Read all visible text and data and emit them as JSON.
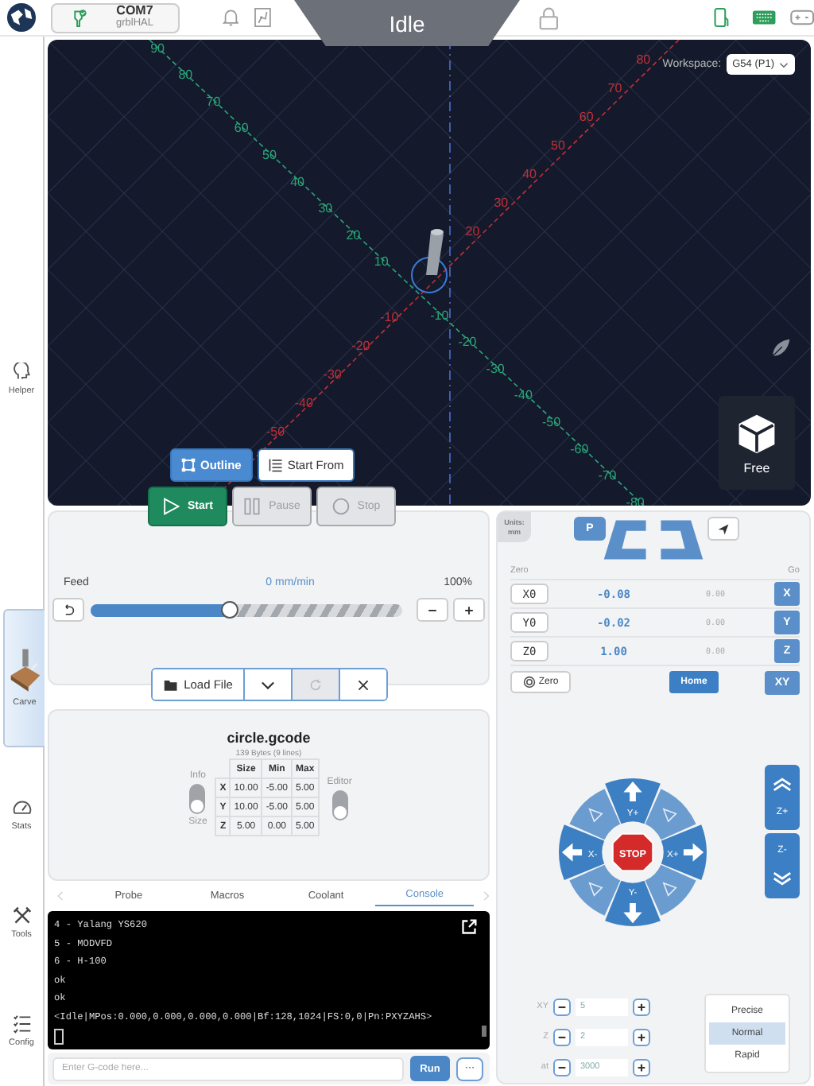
{
  "top_bar": {
    "port": "COM7",
    "firmware": "grblHAL",
    "state": "Idle"
  },
  "sidebar": [
    {
      "label": "Helper",
      "selected": false
    },
    {
      "label": "Carve",
      "selected": true
    },
    {
      "label": "Stats",
      "selected": false
    },
    {
      "label": "Tools",
      "selected": false
    },
    {
      "label": "Config",
      "selected": false
    }
  ],
  "visualizer": {
    "workspace_label": "Workspace:",
    "workspace": "G54 (P1)",
    "free_label": "Free",
    "green_labels": [
      "90",
      "80",
      "70",
      "60",
      "50",
      "40",
      "30",
      "20",
      "10",
      "-10",
      "-20",
      "-30",
      "-40",
      "-50",
      "-60",
      "-70",
      "-80"
    ],
    "red_labels": [
      "80",
      "70",
      "60",
      "50",
      "40",
      "30",
      "20",
      "-10",
      "-20",
      "-30",
      "-40",
      "-50"
    ]
  },
  "job_buttons": [
    {
      "label": "Outline",
      "kind": "outline"
    },
    {
      "label": "Start From",
      "kind": "start-from"
    }
  ],
  "run_buttons": [
    {
      "label": "Start",
      "kind": "start",
      "disabled": false
    },
    {
      "label": "Pause",
      "kind": "pause",
      "disabled": true
    },
    {
      "label": "Stop",
      "kind": "stop",
      "disabled": true
    }
  ],
  "feed": {
    "label": "Feed",
    "rate": "0 mm/min",
    "percent": "100%",
    "level": 0.45
  },
  "file_toolbar": {
    "load": "Load File",
    "reload_disabled": true
  },
  "file": {
    "name": "circle.gcode",
    "meta": "139 Bytes (9 lines)",
    "info_label": "Info",
    "size_label": "Size",
    "size_selected": true,
    "editor_label": "Editor",
    "editor_on": false,
    "columns": [
      "Size",
      "Min",
      "Max"
    ],
    "rows": [
      {
        "axis": "X",
        "values": [
          "10.00",
          "-5.00",
          "5.00"
        ]
      },
      {
        "axis": "Y",
        "values": [
          "10.00",
          "-5.00",
          "5.00"
        ]
      },
      {
        "axis": "Z",
        "values": [
          "5.00",
          "0.00",
          "5.00"
        ]
      }
    ]
  },
  "tabs": [
    {
      "label": "Probe",
      "selected": false
    },
    {
      "label": "Macros",
      "selected": false
    },
    {
      "label": "Coolant",
      "selected": false
    },
    {
      "label": "Console",
      "selected": true
    }
  ],
  "console": {
    "lines": [
      "4 - Yalang YS620",
      "5 - MODVFD",
      "6 - H-100",
      "ok",
      "ok",
      "<Idle|MPos:0.000,0.000,0.000,0.000|Bf:128,1024|FS:0,0|Pn:PXYZAHS>"
    ],
    "placeholder": "Enter G-code here...",
    "run": "Run",
    "more": "···"
  },
  "dro": {
    "units_label": "Units:",
    "units": "mm",
    "p": "P",
    "zero_header": "Zero",
    "go_header": "Go",
    "axes": [
      {
        "zero": "X0",
        "value": "-0.08",
        "machine": "0.00",
        "go": "X"
      },
      {
        "zero": "Y0",
        "value": "-0.02",
        "machine": "0.00",
        "go": "Y"
      },
      {
        "zero": "Z0",
        "value": "1.00",
        "machine": "0.00",
        "go": "Z"
      }
    ],
    "zero_button": "Zero",
    "home": "Home",
    "go_xy": "XY"
  },
  "jog": {
    "stop": "STOP",
    "up": "Y+",
    "down": "Y-",
    "left": "X-",
    "right": "X+",
    "z_up": "Z+",
    "z_down": "Z-",
    "steps": [
      {
        "label": "XY",
        "value": "5"
      },
      {
        "label": "Z",
        "value": "2"
      },
      {
        "label": "at",
        "value": "3000"
      }
    ],
    "speeds": [
      {
        "label": "Precise",
        "selected": false
      },
      {
        "label": "Normal",
        "selected": true
      },
      {
        "label": "Rapid",
        "selected": false
      }
    ]
  }
}
